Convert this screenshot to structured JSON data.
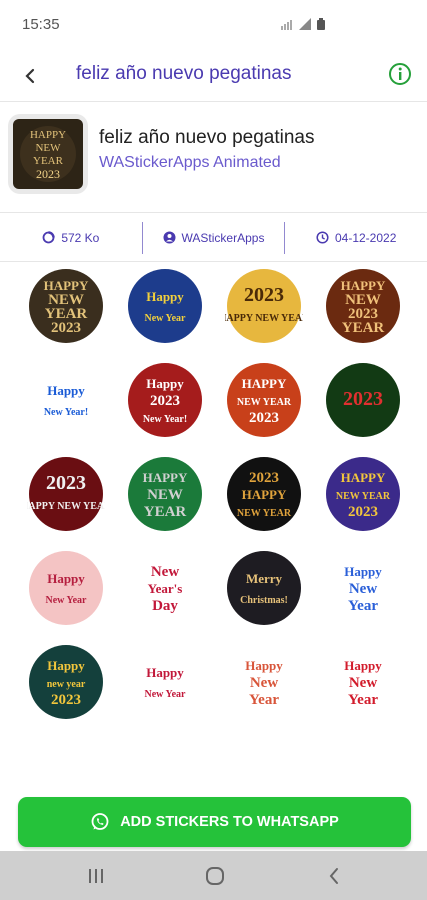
{
  "status_bar": {
    "time": "15:35"
  },
  "app_bar": {
    "title": "feliz año nuevo pegatinas"
  },
  "pack": {
    "title": "feliz año nuevo pegatinas",
    "author": "WAStickerApps Animated",
    "thumb_text": [
      "HAPPY",
      "NEW",
      "YEAR",
      "2023"
    ]
  },
  "info": {
    "size": "572 Ko",
    "publisher": "WAStickerApps",
    "date": "04-12-2022"
  },
  "stickers": [
    {
      "lines": [
        "HAPPY",
        "NEW",
        "YEAR",
        "2023"
      ],
      "bg": "#3a2e1e",
      "fg": "#e2c27a"
    },
    {
      "lines": [
        "Happy",
        "New Year"
      ],
      "bg": "#1d3c8c",
      "fg": "#f2d03c"
    },
    {
      "lines": [
        "2023",
        "HAPPY NEW YEAR"
      ],
      "bg": "#e7b73e",
      "fg": "#4a2a08"
    },
    {
      "lines": [
        "HAPPY",
        "NEW",
        "2023",
        "YEAR"
      ],
      "bg": "#6b2a10",
      "fg": "#f0c17a"
    },
    {
      "lines": [
        "Happy",
        "New Year!"
      ],
      "bg": "#ffffff",
      "fg": "#1a5bd6"
    },
    {
      "lines": [
        "Happy",
        "2023",
        "New Year!"
      ],
      "bg": "#a51c1c",
      "fg": "#ffffff"
    },
    {
      "lines": [
        "HAPPY",
        "NEW YEAR",
        "2023"
      ],
      "bg": "#c8401a",
      "fg": "#ffffff"
    },
    {
      "lines": [
        "2023"
      ],
      "bg": "#123a14",
      "fg": "#e03030"
    },
    {
      "lines": [
        "2023",
        "HAPPY NEW YEAR"
      ],
      "bg": "#6a0e12",
      "fg": "#f0f0f0"
    },
    {
      "lines": [
        "HAPPY",
        "NEW",
        "YEAR"
      ],
      "bg": "#1b7a3a",
      "fg": "#d0d0d0"
    },
    {
      "lines": [
        "2023",
        "HAPPY",
        "NEW YEAR"
      ],
      "bg": "#111111",
      "fg": "#e0a33c"
    },
    {
      "lines": [
        "HAPPY",
        "NEW YEAR",
        "2023"
      ],
      "bg": "#3b2a8a",
      "fg": "#f2c63c"
    },
    {
      "lines": [
        "Happy",
        "New Year"
      ],
      "bg": "#f4c4c4",
      "fg": "#b51f3f"
    },
    {
      "lines": [
        "New",
        "Year's",
        "Day"
      ],
      "bg": "#ffffff",
      "fg": "#c2183a"
    },
    {
      "lines": [
        "Merry",
        "Christmas!"
      ],
      "bg": "#1e1c22",
      "fg": "#e7c27a"
    },
    {
      "lines": [
        "Happy",
        "New",
        "Year"
      ],
      "bg": "#ffffff",
      "fg": "#2a5fd8"
    },
    {
      "lines": [
        "Happy",
        "new year",
        "2023"
      ],
      "bg": "#14403c",
      "fg": "#f2c63c"
    },
    {
      "lines": [
        "Happy",
        "New Year"
      ],
      "bg": "#ffffff",
      "fg": "#c2183a"
    },
    {
      "lines": [
        "Happy",
        "New",
        "Year"
      ],
      "bg": "#ffffff",
      "fg": "#d8553a"
    },
    {
      "lines": [
        "Happy",
        "New",
        "Year"
      ],
      "bg": "#ffffff",
      "fg": "#d21c2c"
    }
  ],
  "add_button": {
    "label": "ADD STICKERS TO WHATSAPP"
  },
  "colors": {
    "accent": "#4a3ab0",
    "author": "#6a5acd",
    "button": "#25c23a",
    "nav": "#cfcfcf"
  },
  "icons": {
    "back": "arrow-left-icon",
    "info": "info-circle-icon",
    "size": "storage-icon",
    "publisher": "account-icon",
    "date": "clock-icon",
    "whatsapp": "whatsapp-icon"
  }
}
